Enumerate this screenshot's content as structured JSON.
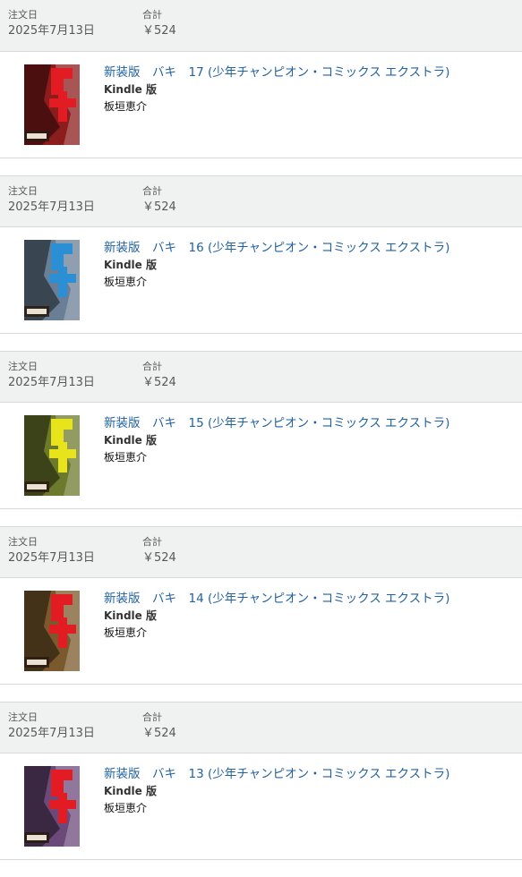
{
  "labels": {
    "order_date": "注文日",
    "total": "合計"
  },
  "orders": [
    {
      "date": "2025年7月13日",
      "total": "￥524",
      "title": "新装版　バキ　17 (少年チャンピオン・コミックス エクストラ)",
      "format": "Kindle 版",
      "author": "板垣恵介",
      "cover_main_color": "#8b1d1d",
      "cover_logo_color": "#e31c23"
    },
    {
      "date": "2025年7月13日",
      "total": "￥524",
      "title": "新装版　バキ　16 (少年チャンピオン・コミックス エクストラ)",
      "format": "Kindle 版",
      "author": "板垣恵介",
      "cover_main_color": "#6a7f96",
      "cover_logo_color": "#2b8fd6"
    },
    {
      "date": "2025年7月13日",
      "total": "￥524",
      "title": "新装版　バキ　15 (少年チャンピオン・コミックス エクストラ)",
      "format": "Kindle 版",
      "author": "板垣恵介",
      "cover_main_color": "#6d7a2e",
      "cover_logo_color": "#e8e41c"
    },
    {
      "date": "2025年7月13日",
      "total": "￥524",
      "title": "新装版　バキ　14 (少年チャンピオン・コミックス エクストラ)",
      "format": "Kindle 版",
      "author": "板垣恵介",
      "cover_main_color": "#7a5a2c",
      "cover_logo_color": "#e31c23"
    },
    {
      "date": "2025年7月13日",
      "total": "￥524",
      "title": "新装版　バキ　13 (少年チャンピオン・コミックス エクストラ)",
      "format": "Kindle 版",
      "author": "板垣恵介",
      "cover_main_color": "#6b4a7a",
      "cover_logo_color": "#e31c23"
    }
  ]
}
